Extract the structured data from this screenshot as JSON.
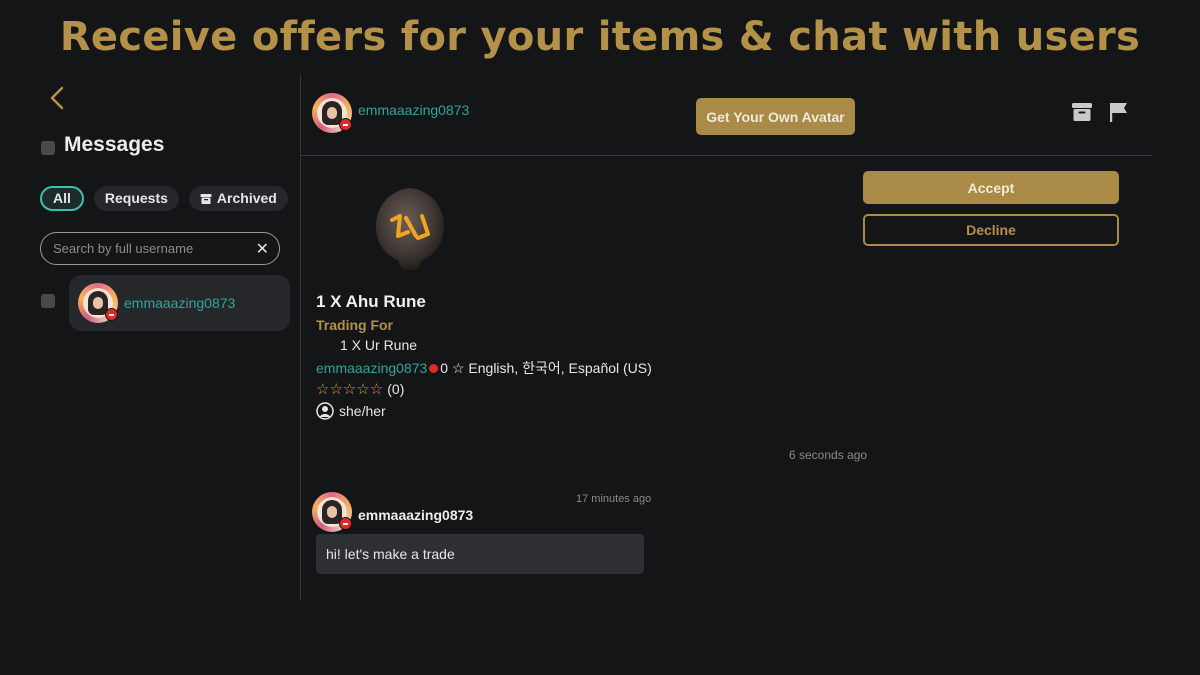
{
  "headline": "Receive offers for your items & chat with users",
  "sidebar": {
    "title": "Messages",
    "filters": {
      "all": "All",
      "requests": "Requests",
      "archived": "Archived"
    },
    "search_placeholder": "Search by full username",
    "conversations": [
      {
        "username": "emmaaazing0873"
      }
    ]
  },
  "chat": {
    "header_username": "emmaaazing0873",
    "get_avatar_label": "Get Your Own Avatar",
    "offer": {
      "item": "1 X Ahu Rune",
      "trading_for_label": "Trading For",
      "trading_for_item": "1 X Ur Rune",
      "seller": "emmaaazing0873",
      "seller_meta": "0 ☆ English, 한국어, Español (US)",
      "stars": "☆☆☆☆☆",
      "rating_count": "(0)",
      "pronouns": "she/her",
      "accept_label": "Accept",
      "decline_label": "Decline",
      "timestamp": "6 seconds ago"
    },
    "message": {
      "username": "emmaaazing0873",
      "timestamp": "17 minutes ago",
      "text": "hi! let's make a trade"
    }
  },
  "colors": {
    "gold": "#b49148",
    "button_gold": "#a98a46",
    "teal": "#2fa59a",
    "background": "#141516"
  },
  "icons": [
    "chevron-left-icon",
    "archive-icon",
    "flag-icon",
    "close-icon",
    "user-circle-icon"
  ]
}
